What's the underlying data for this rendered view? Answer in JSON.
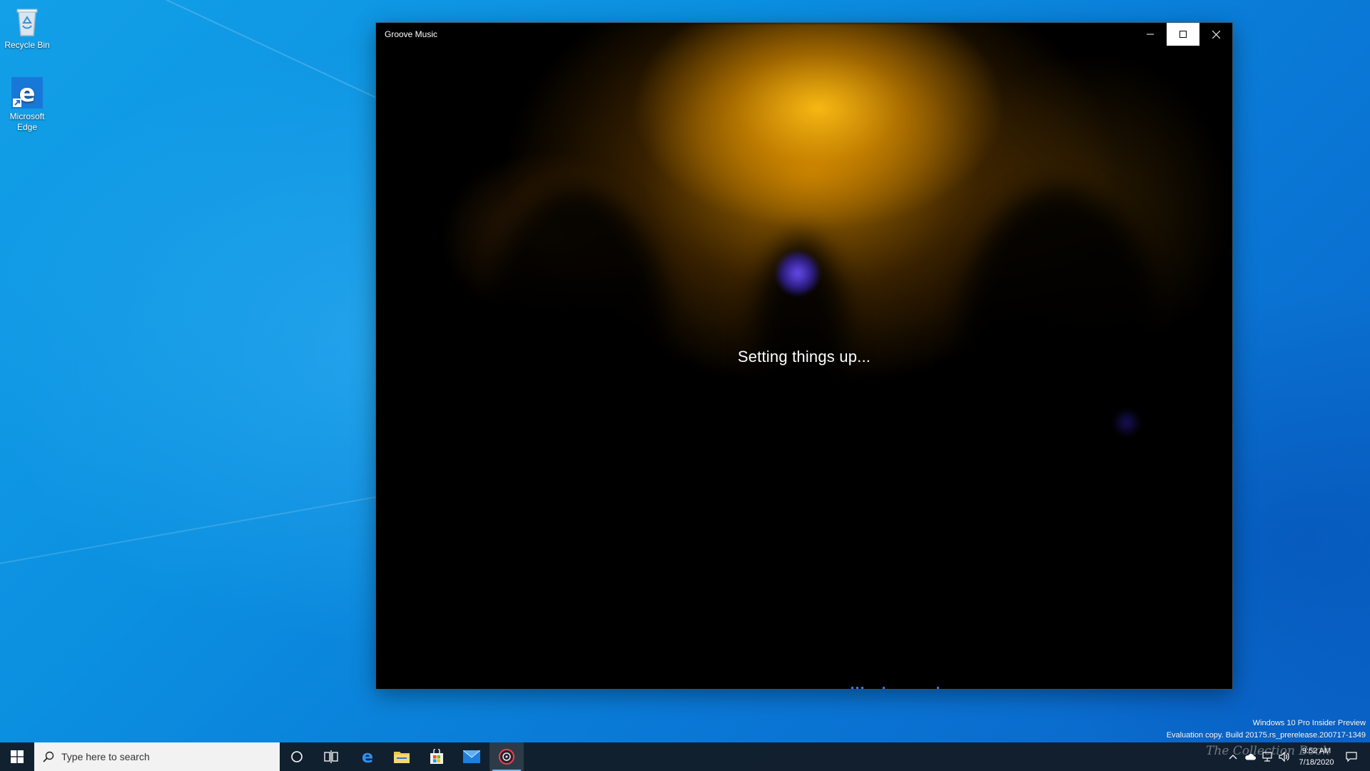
{
  "desktop": {
    "icons": [
      {
        "label": "Recycle Bin"
      },
      {
        "label": "Microsoft Edge"
      }
    ]
  },
  "window": {
    "title": "Groove Music",
    "status_text": "Setting things up...",
    "minimize_glyph": "–",
    "close_glyph": "✕"
  },
  "watermark": {
    "line1": "Windows 10 Pro Insider Preview",
    "line2": "Evaluation copy. Build 20175.rs_prerelease.200717-1349",
    "brand_overlay": "The Collection Book"
  },
  "taskbar": {
    "search_placeholder": "Type here to search",
    "apps": [
      {
        "name": "cortana",
        "icon": "circle-icon"
      },
      {
        "name": "task-view",
        "icon": "task-view-icon"
      },
      {
        "name": "microsoft-edge",
        "icon": "edge-icon"
      },
      {
        "name": "file-explorer",
        "icon": "folder-icon"
      },
      {
        "name": "microsoft-store",
        "icon": "store-icon"
      },
      {
        "name": "mail",
        "icon": "mail-icon"
      },
      {
        "name": "groove-music",
        "icon": "groove-icon",
        "active": true
      }
    ],
    "clock": {
      "time": "9:52 AM",
      "date": "7/18/2020"
    }
  },
  "colors": {
    "accent": "#0a78d6",
    "taskbar": "#121c28",
    "progress": "#2f7bff"
  }
}
